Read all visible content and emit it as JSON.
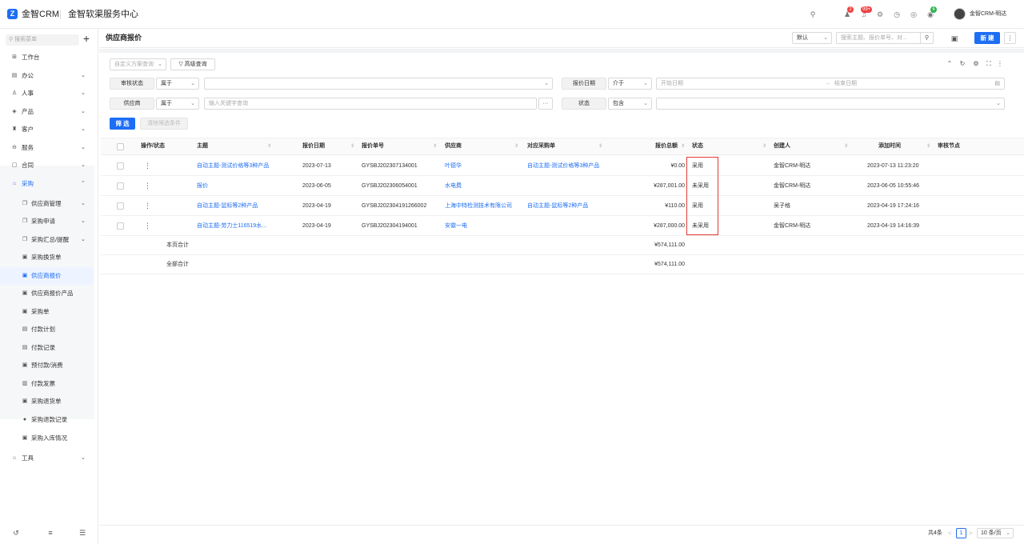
{
  "brand": {
    "logo_glyph": "Z",
    "name": "金智CRM",
    "center_title": "金智软渠服务中心"
  },
  "topbar": {
    "icons": [
      "search-icon",
      "contacts-icon",
      "bell-icon",
      "settings-icon",
      "clock-icon",
      "help-icon",
      "chat-icon"
    ],
    "badge_contacts": "2",
    "badge_bell": "99+",
    "badge_chat": "6",
    "user_name": "金智CRM-明达"
  },
  "sidebar": {
    "search_placeholder": "搜索菜单",
    "add_glyph": "+",
    "items": [
      {
        "label": "工作台",
        "icon": "⊞"
      },
      {
        "label": "办公",
        "icon": "▤"
      },
      {
        "label": "人事",
        "icon": "♙"
      },
      {
        "label": "产品",
        "icon": "◈"
      },
      {
        "label": "客户",
        "icon": "♜"
      },
      {
        "label": "服务",
        "icon": "⊖"
      },
      {
        "label": "合同",
        "icon": "▢"
      },
      {
        "label": "采购",
        "icon": "⌂"
      }
    ],
    "sub_items": [
      {
        "label": "供应商管理",
        "icon": "❐"
      },
      {
        "label": "采购申请",
        "icon": "❐"
      },
      {
        "label": "采购汇总/提醒",
        "icon": "❐"
      },
      {
        "label": "采购换货单",
        "icon": "▣"
      },
      {
        "label": "供应商报价",
        "icon": "▣"
      },
      {
        "label": "供应商报价产品",
        "icon": "▣"
      },
      {
        "label": "采购单",
        "icon": "▣"
      },
      {
        "label": "付款计划",
        "icon": "▤"
      },
      {
        "label": "付款记录",
        "icon": "▤"
      },
      {
        "label": "预付款/消费",
        "icon": "▣"
      },
      {
        "label": "付款发票",
        "icon": "▥"
      },
      {
        "label": "采购退货单",
        "icon": "▣"
      },
      {
        "label": "采购退款记录",
        "icon": "●"
      },
      {
        "label": "采购入库情况",
        "icon": "▣"
      }
    ],
    "tools_label": "工具",
    "tools_icon": "⌂",
    "chevron": "⌄",
    "chevron_up": "⌃"
  },
  "header": {
    "title": "供应商报价",
    "view_select": "默认",
    "search_placeholder": "搜索主题、报价单号、对...",
    "new_label": "新 建",
    "more_glyph": "⋮"
  },
  "filters": {
    "plan_placeholder": "自定义方案查询",
    "advanced_label": "高级查询",
    "approval_label": "审核状态",
    "approval_op": "属于",
    "date_label": "报价日期",
    "date_op": "介于",
    "date_start_placeholder": "开始日期",
    "date_end_placeholder": "结束日期",
    "date_arrow": "→",
    "supplier_label": "供应商",
    "supplier_op": "属于",
    "supplier_placeholder": "输入关键字查询",
    "supplier_dots": "···",
    "status_label": "状态",
    "status_op": "包含",
    "filter_btn": "筛 选",
    "clear_btn": "清除筛选条件"
  },
  "table": {
    "columns": {
      "action": "操作/状态",
      "subject": "主题",
      "date": "报价日期",
      "number": "报价单号",
      "supplier": "供应商",
      "order": "对应采购单",
      "total": "报价总额",
      "status": "状态",
      "creator": "创建人",
      "added": "添加时间",
      "node": "审核节点"
    },
    "rows": [
      {
        "subject": "自动主题-测试价格等3种产品",
        "date": "2023-07-13",
        "number": "GYSBJ202307134001",
        "supplier": "叶德华",
        "order": "自动主题-测试价格等3种产品",
        "total": "¥0.00",
        "status": "采用",
        "creator": "金智CRM-明达",
        "added": "2023-07-13 11:23:20"
      },
      {
        "subject": "报价",
        "date": "2023-06-05",
        "number": "GYSBJ202306054001",
        "supplier": "水电费",
        "order": "",
        "total": "¥287,001.00",
        "status": "未采用",
        "creator": "金智CRM-明达",
        "added": "2023-06-05 10:55:46"
      },
      {
        "subject": "自动主题-鼠标等2种产品",
        "date": "2023-04-19",
        "number": "GYSBJ202304191266002",
        "supplier": "上海中特检测技术有限公司",
        "order": "自动主题-鼠标等2种产品",
        "total": "¥110.00",
        "status": "采用",
        "creator": "吴子格",
        "added": "2023-04-19 17:24:16"
      },
      {
        "subject": "自动主题-劳力士116519水...",
        "date": "2023-04-19",
        "number": "GYSBJ202304194001",
        "supplier": "安徽一电",
        "order": "",
        "total": "¥287,000.00",
        "status": "未采用",
        "creator": "金智CRM-明达",
        "added": "2023-04-19 14:16:39"
      }
    ],
    "row_dots": "⋮",
    "page_sum_label": "本页合计",
    "page_sum_value": "¥574,111.00",
    "all_sum_label": "全部合计",
    "all_sum_value": "¥574,111.00"
  },
  "pagination": {
    "total": "共4条",
    "prev": "<",
    "current": "1",
    "next": ">",
    "page_size": "10 条/页"
  },
  "colors": {
    "accent": "#1e6ef5",
    "highlight_box": "#e53935"
  }
}
